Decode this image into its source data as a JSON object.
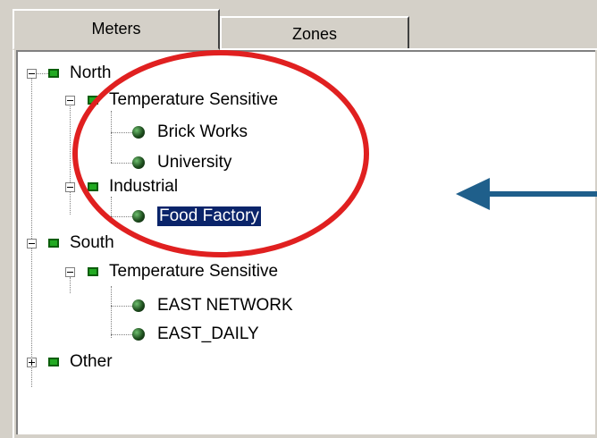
{
  "tabs": [
    {
      "label": "Meters",
      "active": true
    },
    {
      "label": "Zones",
      "active": false
    }
  ],
  "tree": {
    "north": {
      "label": "North",
      "expanded": true
    },
    "north_temp": {
      "label": "Temperature Sensitive",
      "expanded": true
    },
    "brick_works": {
      "label": "Brick Works"
    },
    "university": {
      "label": "University"
    },
    "industrial": {
      "label": "Industrial",
      "expanded": true
    },
    "food_factory": {
      "label": "Food Factory",
      "selected": true
    },
    "south": {
      "label": "South",
      "expanded": true
    },
    "south_temp": {
      "label": "Temperature Sensitive",
      "expanded": true
    },
    "east_network": {
      "label": "EAST NETWORK"
    },
    "east_daily": {
      "label": "EAST_DAILY"
    },
    "other": {
      "label": "Other",
      "expanded": false
    }
  },
  "annotations": {
    "circle_color": "#e02020",
    "arrow_color": "#1f5f8b"
  },
  "icons": {
    "group": "green-square-icon",
    "meter": "green-globe-icon"
  }
}
